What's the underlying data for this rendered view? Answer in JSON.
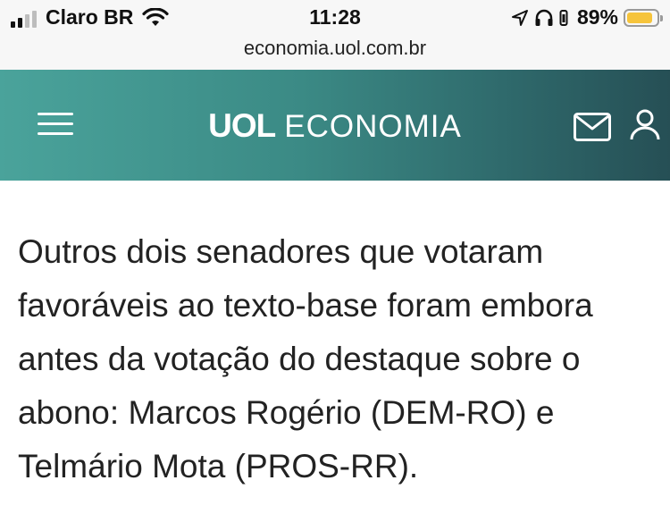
{
  "status_bar": {
    "carrier": "Claro BR",
    "time": "11:28",
    "battery_percent": "89%",
    "battery_level": 0.89,
    "battery_color": "#f6c43b",
    "icons": [
      "signal-icon",
      "wifi-icon",
      "location-arrow-icon",
      "headphones-icon",
      "battery-icon"
    ]
  },
  "browser": {
    "url": "economia.uol.com.br"
  },
  "header": {
    "brand": "UOL",
    "section": "ECONOMIA",
    "icons": [
      "hamburger-menu-icon",
      "mail-icon",
      "user-icon"
    ],
    "gradient_colors": [
      "#4aa39b",
      "#264f55"
    ]
  },
  "article": {
    "paragraph": "Outros dois senadores que votaram favoráveis ao texto-base foram embora antes da votação do destaque sobre o abono: Marcos Rogério (DEM-RO) e Telmário Mota (PROS-RR)."
  }
}
